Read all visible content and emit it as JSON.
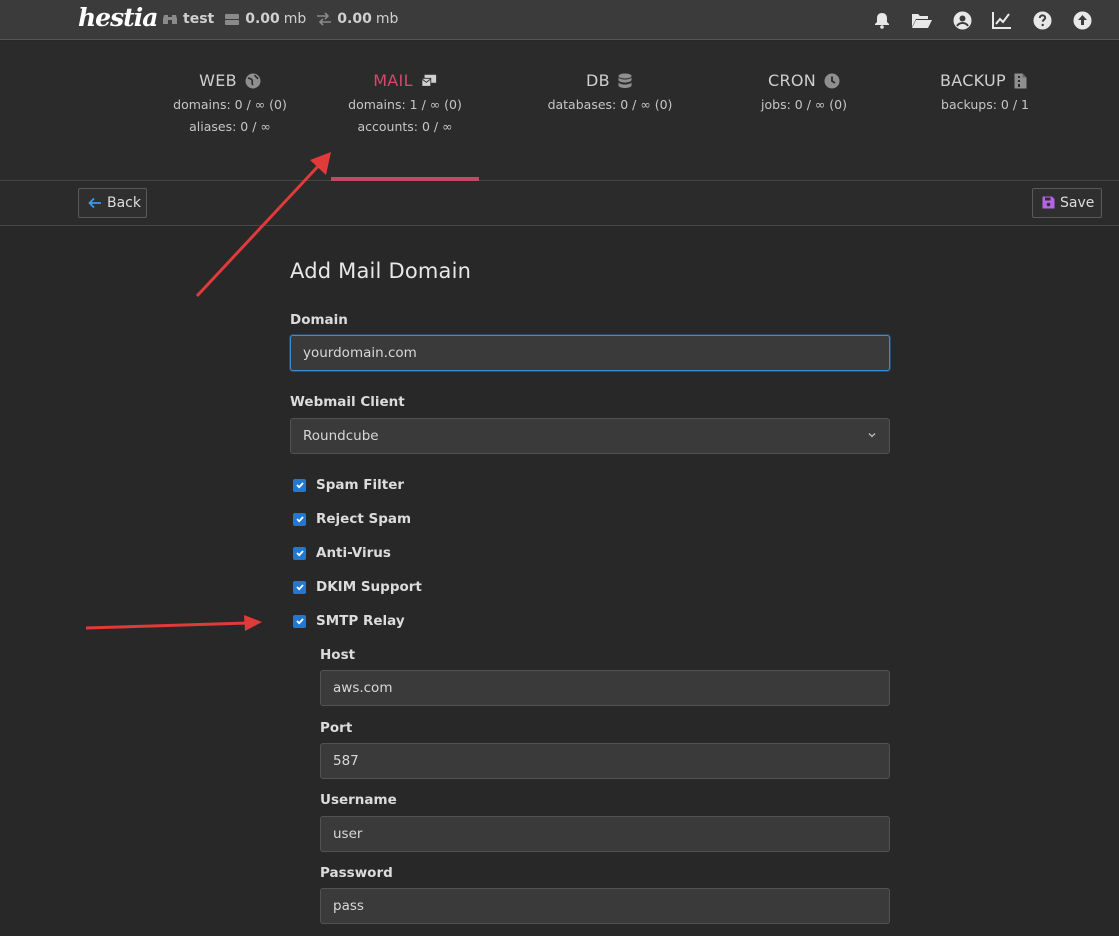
{
  "topbar": {
    "logo": "hestia",
    "user": "test",
    "disk": "0.00",
    "disk_unit": "mb",
    "bandwidth": "0.00",
    "bandwidth_unit": "mb",
    "icons": [
      "bell-icon",
      "folder-open-icon",
      "user-circle-icon",
      "chart-line-icon",
      "help-icon",
      "upload-icon"
    ]
  },
  "panels": [
    {
      "title": "WEB",
      "icon": "globe-icon",
      "stats": [
        "domains: 0 / ∞ (0)",
        "aliases: 0 / ∞"
      ]
    },
    {
      "title": "MAIL",
      "icon": "mail-bulk-icon",
      "stats": [
        "domains: 1 / ∞ (0)",
        "accounts: 0 / ∞"
      ],
      "active": true
    },
    {
      "title": "DB",
      "icon": "database-icon",
      "stats": [
        "databases: 0 / ∞ (0)"
      ]
    },
    {
      "title": "CRON",
      "icon": "clock-icon",
      "stats": [
        "jobs: 0 / ∞ (0)"
      ]
    },
    {
      "title": "BACKUP",
      "icon": "file-archive-icon",
      "stats": [
        "backups: 0 / 1"
      ]
    }
  ],
  "toolbar": {
    "back_label": "Back",
    "save_label": "Save"
  },
  "form": {
    "title": "Add Mail Domain",
    "domain_label": "Domain",
    "domain_value": "yourdomain.com",
    "webmail_label": "Webmail Client",
    "webmail_value": "Roundcube",
    "checkboxes": [
      {
        "label": "Spam Filter",
        "checked": true
      },
      {
        "label": "Reject Spam",
        "checked": true
      },
      {
        "label": "Anti-Virus",
        "checked": true
      },
      {
        "label": "DKIM Support",
        "checked": true
      },
      {
        "label": "SMTP Relay",
        "checked": true
      }
    ],
    "relay": {
      "host_label": "Host",
      "host_value": "aws.com",
      "port_label": "Port",
      "port_value": "587",
      "username_label": "Username",
      "username_value": "user",
      "password_label": "Password",
      "password_value": "pass"
    }
  },
  "colors": {
    "accent": "#d7476d",
    "checkbox": "#1f78d1",
    "focus": "#3d8bd4",
    "annotation": "#e03a3a",
    "save_icon": "#b463e3",
    "back_icon": "#3d9be9"
  }
}
